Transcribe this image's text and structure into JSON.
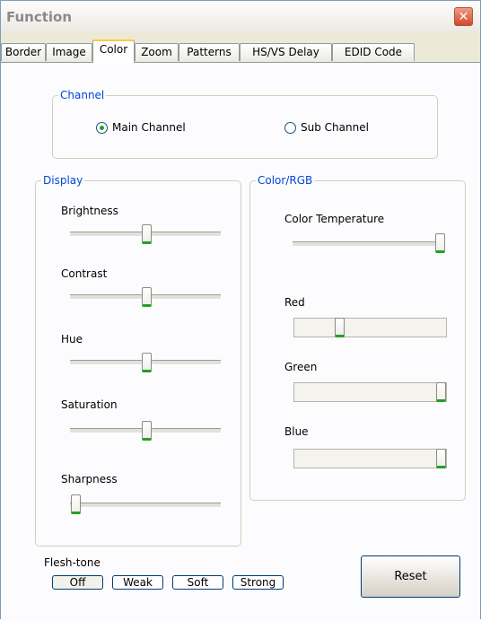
{
  "window": {
    "title": "Function",
    "close_glyph": "✕"
  },
  "tabs": [
    "Border",
    "Image",
    "Color",
    "Zoom",
    "Patterns",
    "HS/VS Delay",
    "EDID Code"
  ],
  "active_tab": "Color",
  "channel": {
    "legend": "Channel",
    "options": [
      {
        "label": "Main Channel",
        "selected": true
      },
      {
        "label": "Sub Channel",
        "selected": false
      }
    ]
  },
  "display": {
    "legend": "Display",
    "sliders": [
      {
        "label": "Brightness",
        "value": 0.5
      },
      {
        "label": "Contrast",
        "value": 0.5
      },
      {
        "label": "Hue",
        "value": 0.5
      },
      {
        "label": "Saturation",
        "value": 0.5
      },
      {
        "label": "Sharpness",
        "value": 0.0
      }
    ]
  },
  "color_rgb": {
    "legend": "Color/RGB",
    "color_temperature": {
      "label": "Color Temperature",
      "value": 1.0
    },
    "channels": [
      {
        "label": "Red",
        "value": 0.3
      },
      {
        "label": "Green",
        "value": 1.0
      },
      {
        "label": "Blue",
        "value": 1.0
      }
    ]
  },
  "flesh_tone": {
    "label": "Flesh-tone",
    "options": [
      {
        "label": "Off",
        "selected": true
      },
      {
        "label": "Weak",
        "selected": false
      },
      {
        "label": "Soft",
        "selected": false
      },
      {
        "label": "Strong",
        "selected": false
      }
    ]
  },
  "reset_label": "Reset"
}
